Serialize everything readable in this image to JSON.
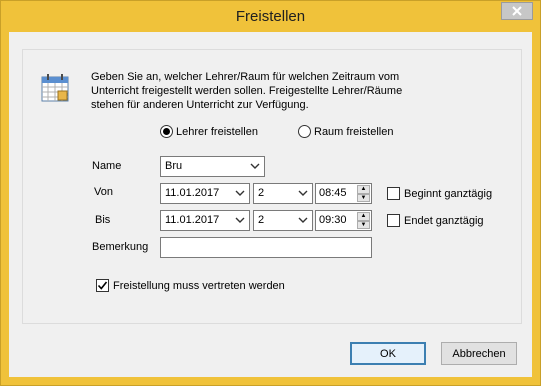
{
  "window": {
    "title": "Freistellen"
  },
  "description": "Geben Sie an, welcher Lehrer/Raum für welchen Zeitraum vom Unterricht freigestellt werden sollen. Freigestellte Lehrer/Räume stehen für anderen Unterricht zur Verfügung.",
  "mode": {
    "option_teacher": "Lehrer freistellen",
    "option_room": "Raum freistellen",
    "selected": "teacher"
  },
  "form": {
    "name_label": "Name",
    "name_value": "Bru",
    "from_label": "Von",
    "from_date": "11.01.2017",
    "from_period": "2",
    "from_time": "08:45",
    "from_allday_label": "Beginnt ganztägig",
    "to_label": "Bis",
    "to_date": "11.01.2017",
    "to_period": "2",
    "to_time": "09:30",
    "to_allday_label": "Endet ganztägig",
    "remark_label": "Bemerkung",
    "remark_value": "",
    "substitute_label": "Freistellung muss vertreten werden"
  },
  "buttons": {
    "ok": "OK",
    "cancel": "Abbrechen"
  },
  "icons": {
    "close": "close-icon",
    "calendar": "calendar-icon",
    "dropdown": "chevron-down-icon",
    "spin_up": "spin-up-icon",
    "spin_down": "spin-down-icon"
  },
  "colors": {
    "frame": "#f0c23a",
    "client": "#f0f0f0",
    "default_button_border": "#3c7fb1"
  }
}
